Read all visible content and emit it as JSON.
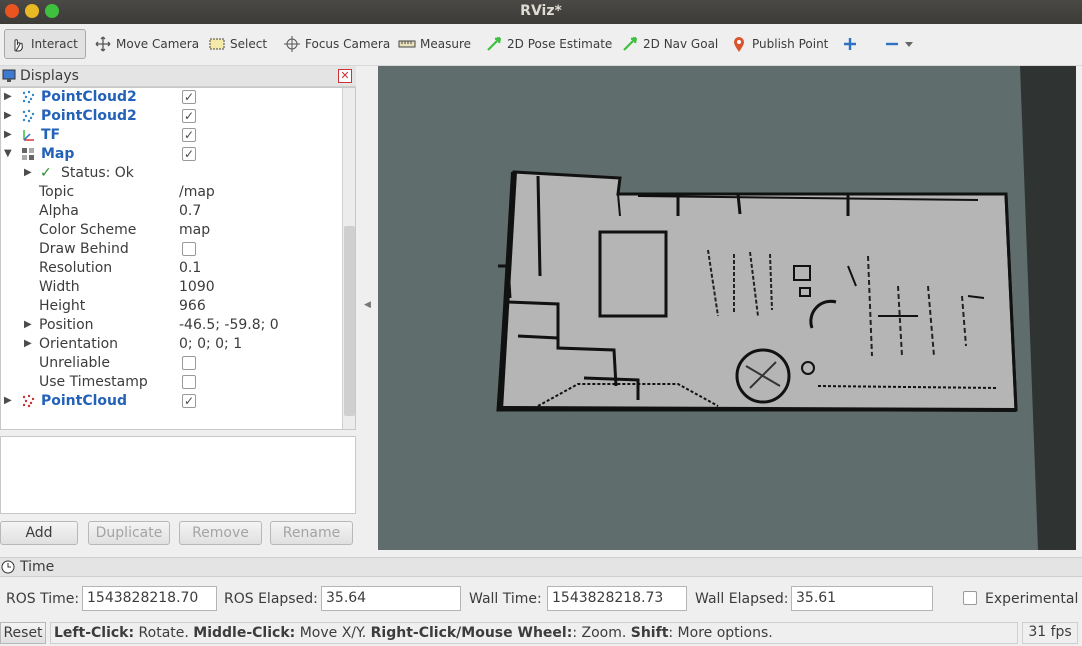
{
  "window": {
    "title": "RViz*"
  },
  "toolbar": {
    "tools": [
      {
        "label": "Interact",
        "icon": "hand-pointer-icon"
      },
      {
        "label": "Move Camera",
        "icon": "move-arrows-icon"
      },
      {
        "label": "Select",
        "icon": "select-rect-icon"
      },
      {
        "label": "Focus Camera",
        "icon": "crosshair-icon"
      },
      {
        "label": "Measure",
        "icon": "ruler-icon"
      },
      {
        "label": "2D Pose Estimate",
        "icon": "green-arrow-icon"
      },
      {
        "label": "2D Nav Goal",
        "icon": "green-arrow-icon"
      },
      {
        "label": "Publish Point",
        "icon": "map-pin-icon"
      }
    ],
    "accent_blue": "#2f72c4",
    "accent_green": "#3fbf3f",
    "pin_color": "#d9532c"
  },
  "displays": {
    "title": "Displays",
    "items": [
      {
        "name": "PointCloud2",
        "checked": true
      },
      {
        "name": "PointCloud2",
        "checked": true
      },
      {
        "name": "TF",
        "checked": true
      },
      {
        "name": "Map",
        "checked": true
      }
    ],
    "map_props": {
      "status": "Status: Ok",
      "topic_label": "Topic",
      "topic": "/map",
      "alpha_label": "Alpha",
      "alpha": "0.7",
      "color_scheme_label": "Color Scheme",
      "color_scheme": "map",
      "draw_behind_label": "Draw Behind",
      "resolution_label": "Resolution",
      "resolution": "0.1",
      "width_label": "Width",
      "width": "1090",
      "height_label": "Height",
      "height": "966",
      "position_label": "Position",
      "position": "-46.5; -59.8; 0",
      "orientation_label": "Orientation",
      "orientation": "0; 0; 0; 1",
      "unreliable_label": "Unreliable",
      "use_timestamp_label": "Use Timestamp"
    },
    "last_item": {
      "name": "PointCloud",
      "checked": true
    },
    "buttons": {
      "add": "Add",
      "duplicate": "Duplicate",
      "remove": "Remove",
      "rename": "Rename"
    }
  },
  "time": {
    "title": "Time",
    "ros_time_label": "ROS Time:",
    "ros_time": "1543828218.70",
    "ros_elapsed_label": "ROS Elapsed:",
    "ros_elapsed": "35.64",
    "wall_time_label": "Wall Time:",
    "wall_time": "1543828218.73",
    "wall_elapsed_label": "Wall Elapsed:",
    "wall_elapsed": "35.61",
    "experimental_label": "Experimental"
  },
  "status": {
    "reset": "Reset",
    "hint_parts": [
      {
        "bold": "Left-Click:",
        "text": " Rotate. "
      },
      {
        "bold": "Middle-Click:",
        "text": " Move X/Y. "
      },
      {
        "bold": "Right-Click/Mouse Wheel:",
        "text": ": Zoom. "
      },
      {
        "bold": "Shift",
        "text": ": More options."
      }
    ],
    "fps": "31 fps"
  },
  "viewport": {
    "background": "#5f6e6c",
    "map_free": "#b5b5b5",
    "map_occupied": "#111111"
  }
}
